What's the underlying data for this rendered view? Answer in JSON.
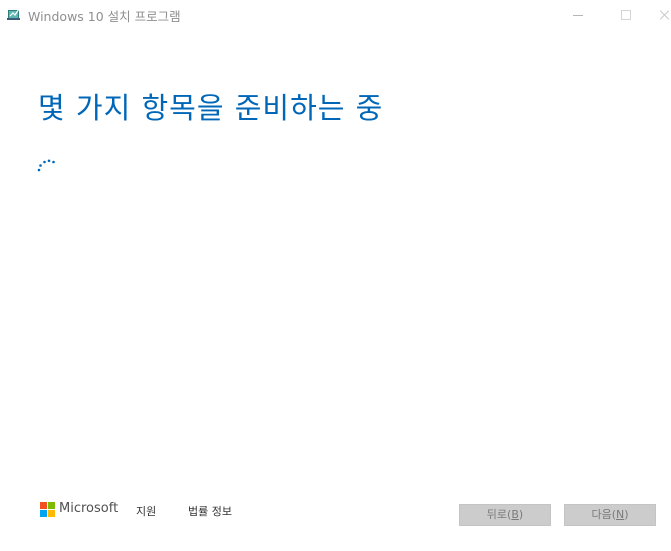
{
  "window": {
    "title": "Windows 10 설치 프로그램"
  },
  "main": {
    "heading": "몇 가지 항목을 준비하는 중"
  },
  "footer": {
    "brand": "Microsoft",
    "support_label": "지원",
    "legal_label": "법률 정보",
    "back_button": {
      "label": "뒤로(",
      "accel": "B",
      "suffix": ")"
    },
    "next_button": {
      "label": "다음(",
      "accel": "N",
      "suffix": ")"
    }
  },
  "colors": {
    "accent": "#0067b8",
    "button_bg": "#cccccc",
    "button_text": "#7a7a7a"
  },
  "icons": {
    "app": "setup-app-icon",
    "spinner": "loading-spinner-icon",
    "logo": "microsoft-logo-icon"
  }
}
